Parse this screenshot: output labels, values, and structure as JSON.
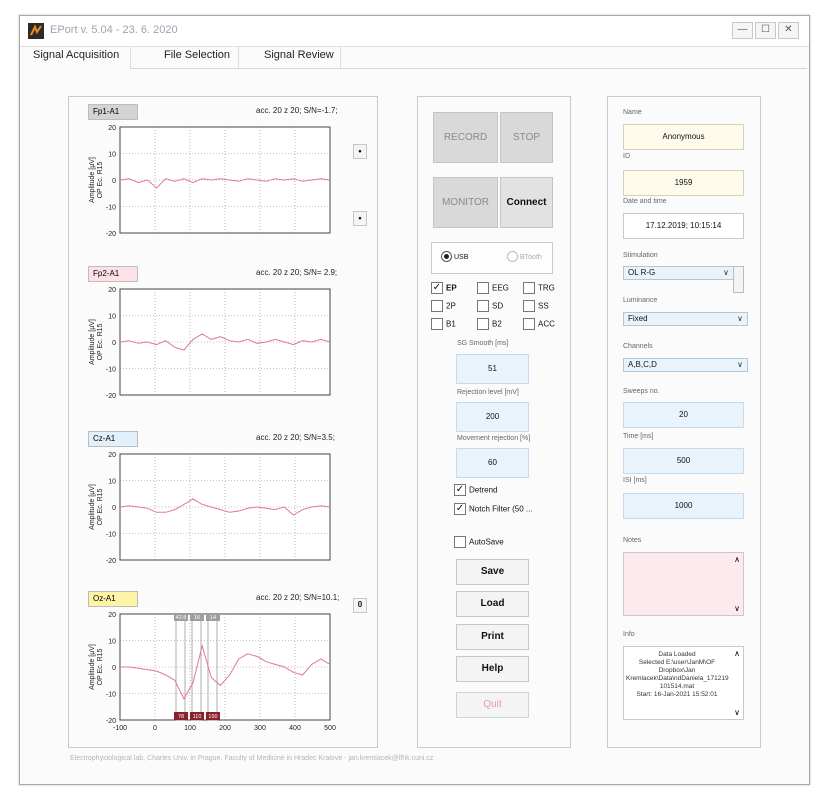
{
  "window": {
    "title": "EPort v. 5.04 - 23. 6. 2020",
    "controls": {
      "minimize": "—",
      "maximize": "☐",
      "close": "✕"
    }
  },
  "tabs": [
    "Signal Acquisition",
    "File Selection",
    "Signal Review"
  ],
  "plots": [
    {
      "label": "Fp1-A1",
      "label_bg": "#d4d4d4",
      "info": "acc. 20 z 20; S/N=-1.7;",
      "yticks": [
        "20",
        "10",
        "0",
        "-10",
        "-20"
      ],
      "ylabel_1": "Amplitude [µV]",
      "ylabel_2": "OP Ec. R15",
      "y": [
        0,
        0.5,
        -1,
        0,
        -3,
        0.5,
        -0.5,
        0.5,
        -1,
        0.5,
        0,
        0.5,
        0,
        -0.5,
        0.5,
        0,
        -0.5,
        0.5,
        0,
        0.5,
        -0.5,
        0,
        0.5,
        0
      ]
    },
    {
      "label": "Fp2-A1",
      "label_bg": "#fde1e6",
      "info": "acc. 20 z 20; S/N= 2.9;",
      "yticks": [
        "20",
        "10",
        "0",
        "-10",
        "-20"
      ],
      "ylabel_1": "Amplitude [µV]",
      "ylabel_2": "OP Ec. R15",
      "y": [
        0,
        0.5,
        -0.5,
        0,
        -1,
        0.5,
        -2,
        -3,
        1,
        3,
        1,
        2,
        0.5,
        0,
        1,
        -0.5,
        0,
        1,
        0,
        -1,
        0.5,
        0,
        1,
        0
      ]
    },
    {
      "label": "Cz-A1",
      "label_bg": "#e2f0fb",
      "info": "acc. 20 z 20; S/N=3.5;",
      "yticks": [
        "20",
        "10",
        "0",
        "-10",
        "-20"
      ],
      "ylabel_1": "Amplitude [µV]",
      "ylabel_2": "OP Ec. R15",
      "y": [
        0,
        0.5,
        0,
        -0.5,
        -2,
        -2,
        -1,
        1,
        3,
        1,
        0,
        -1,
        -2,
        -1.5,
        -0.5,
        0,
        -0.5,
        -1,
        0,
        -3,
        -1,
        0,
        0.5,
        0
      ]
    },
    {
      "label": "Oz-A1",
      "label_bg": "#fff3a8",
      "info": "acc. 20 z 20; S/N=10.1;",
      "yticks": [
        "20",
        "10",
        "0",
        "-10",
        "-20"
      ],
      "ylabel_1": "Amplitude [µV]",
      "ylabel_2": "OP Ec. R15",
      "xticks": [
        "-100",
        "0",
        "100",
        "200",
        "300",
        "400",
        "500"
      ],
      "y": [
        0,
        0,
        -0.5,
        -1,
        -1.5,
        -3,
        -5,
        -12,
        -6,
        8,
        -4,
        -7,
        -3,
        3,
        5,
        4,
        2,
        1,
        0,
        -2,
        -3,
        1,
        3,
        1
      ]
    }
  ],
  "markers": {
    "top": [
      "42.8",
      "16",
      "14"
    ],
    "bottom": [
      "78",
      "110",
      "150"
    ]
  },
  "side_buttons": [
    "•",
    "•",
    "0"
  ],
  "controls": {
    "record": "RECORD",
    "stop": "STOP",
    "monitor": "MONITOR",
    "connect": "Connect",
    "usb": "USB",
    "btooth": "BTooth",
    "checks": [
      {
        "label": "EP",
        "checked": true
      },
      {
        "label": "EEG",
        "checked": false
      },
      {
        "label": "TRG",
        "checked": false
      },
      {
        "label": "2P",
        "checked": false
      },
      {
        "label": "SD",
        "checked": false
      },
      {
        "label": "SS",
        "checked": false
      },
      {
        "label": "B1",
        "checked": false
      },
      {
        "label": "B2",
        "checked": false
      },
      {
        "label": "ACC",
        "checked": false
      }
    ],
    "smooth_label": "SG Smooth [ms]",
    "smooth_value": "51",
    "rejection_label": "Rejection level [mV]",
    "rejection_value": "200",
    "movement_label": "Movement rejection [%]",
    "movement_value": "60",
    "detrend": "Detrend",
    "notch": "Notch Filter (50 ...",
    "autosave": "AutoSave",
    "save": "Save",
    "load": "Load",
    "print": "Print",
    "help": "Help",
    "quit": "Quit"
  },
  "right": {
    "name_label": "Name",
    "name_value": "Anonymous",
    "id_label": "ID",
    "id_value": "1959",
    "date_label": "Date and time",
    "date_value": "17.12.2019; 10:15:14",
    "stim_label": "Stimulation",
    "stim_value": "OL R-G",
    "lum_label": "Luminance",
    "lum_value": "Fixed",
    "chan_label": "Channels",
    "chan_value": "A,B,C,D",
    "sweeps_label": "Sweeps no.",
    "sweeps_value": "20",
    "time_label": "Time [ms]",
    "time_value": "500",
    "isi_label": "ISI [ms]",
    "isi_value": "1000",
    "notes_label": "Notes",
    "info_label": "Info",
    "info_lines": [
      "Data Loaded",
      "Selected E:\\user\\JanM\\OF",
      "Dropbox\\Jan",
      "Kremlacek\\Data\\ndDaniela_171219",
      "101514.mat",
      "Start: 16-Jan-2021 15:52:01"
    ]
  },
  "footer": "Electrophysiological lab, Charles Univ. in Prague, Faculty of Medicine in Hradec Kralove - jan.kremlacek@lfhk.cuni.cz"
}
